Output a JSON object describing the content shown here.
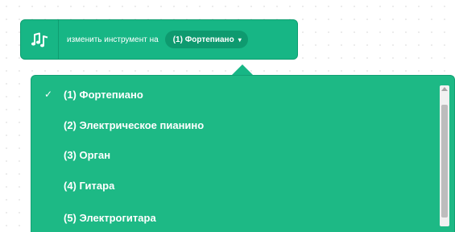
{
  "block": {
    "icon": "music-notes-icon",
    "label": "изменить инструмент на",
    "dropdown_value": "(1) Фортепиано",
    "caret": "▾"
  },
  "menu": {
    "check_mark": "✓",
    "items": [
      {
        "label": "(1) Фортепиано",
        "selected": true
      },
      {
        "label": "(2) Электрическое пианино",
        "selected": false
      },
      {
        "label": "(3) Орган",
        "selected": false
      },
      {
        "label": "(4) Гитара",
        "selected": false
      },
      {
        "label": "(5) Электрогитара",
        "selected": false
      }
    ]
  },
  "colors": {
    "block": "#17b685",
    "dropdown": "#0e9a6f",
    "menu": "#1db985"
  }
}
